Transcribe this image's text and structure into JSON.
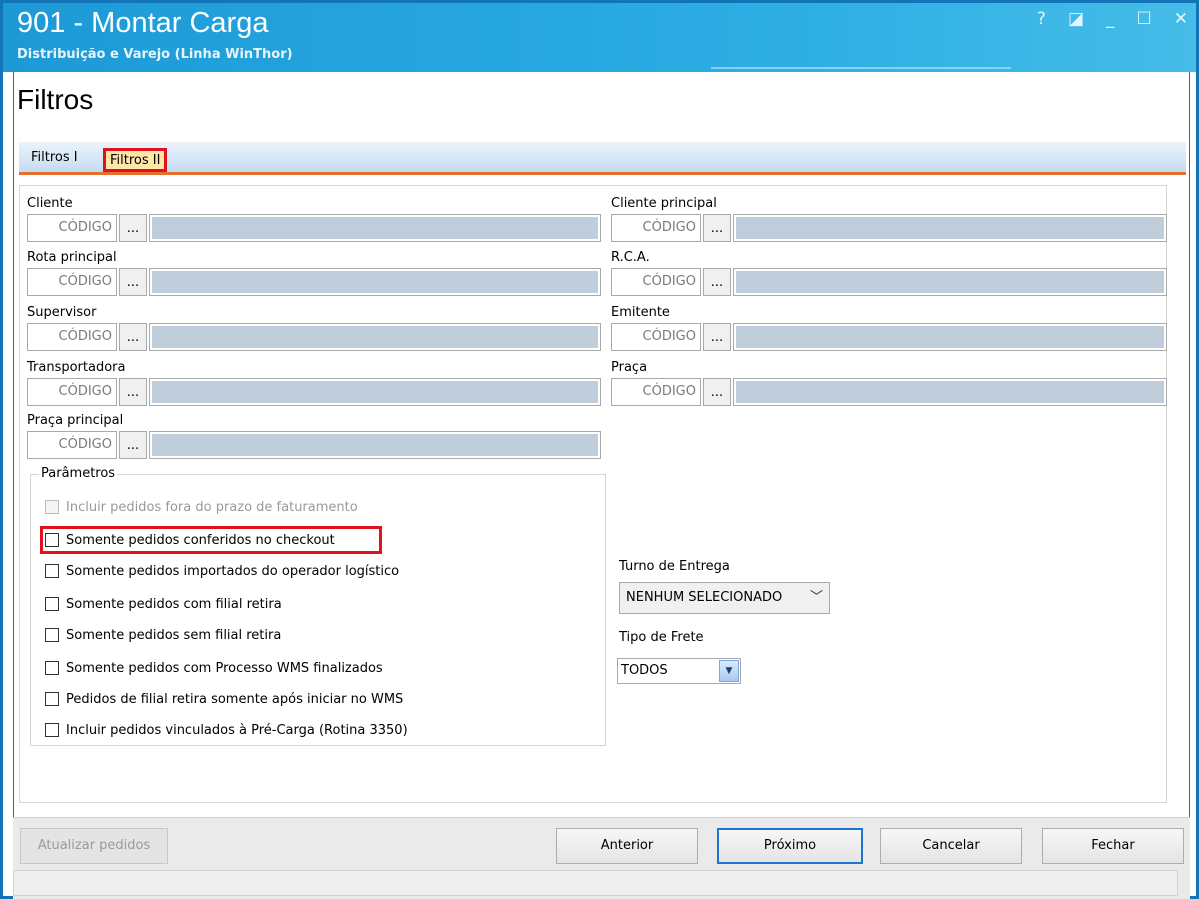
{
  "window": {
    "title": "901 - Montar Carga",
    "subtitle": "Distribuição e Varejo (Linha WinThor)",
    "controls": {
      "help": "?",
      "restore": "◪",
      "minimize": "_",
      "maximize": "☐",
      "close": "✕"
    }
  },
  "page": {
    "title": "Filtros"
  },
  "tabs": [
    {
      "label": "Filtros I",
      "active": false
    },
    {
      "label": "Filtros II",
      "active": true
    }
  ],
  "fields_left": [
    {
      "label": "Cliente",
      "code_placeholder": "CÓDIGO",
      "lookup": "..."
    },
    {
      "label": "Rota principal",
      "code_placeholder": "CÓDIGO",
      "lookup": "..."
    },
    {
      "label": "Supervisor",
      "code_placeholder": "CÓDIGO",
      "lookup": "..."
    },
    {
      "label": "Transportadora",
      "code_placeholder": "CÓDIGO",
      "lookup": "..."
    },
    {
      "label": "Praça principal",
      "code_placeholder": "CÓDIGO",
      "lookup": "..."
    }
  ],
  "fields_right": [
    {
      "label": "Cliente principal",
      "code_placeholder": "CÓDIGO",
      "lookup": "..."
    },
    {
      "label": "R.C.A.",
      "code_placeholder": "CÓDIGO",
      "lookup": "..."
    },
    {
      "label": "Emitente",
      "code_placeholder": "CÓDIGO",
      "lookup": "..."
    },
    {
      "label": "Praça",
      "code_placeholder": "CÓDIGO",
      "lookup": "..."
    }
  ],
  "parametros": {
    "title": "Parâmetros",
    "options": [
      {
        "label": "Incluir pedidos fora do prazo de faturamento",
        "checked": false,
        "enabled": false
      },
      {
        "label": "Somente pedidos conferidos no checkout",
        "checked": false,
        "enabled": true
      },
      {
        "label": "Somente pedidos importados do operador logístico",
        "checked": false,
        "enabled": true
      },
      {
        "label": "Somente pedidos com filial retira",
        "checked": false,
        "enabled": true
      },
      {
        "label": "Somente pedidos sem filial retira",
        "checked": false,
        "enabled": true
      },
      {
        "label": "Somente pedidos com Processo WMS finalizados",
        "checked": false,
        "enabled": true
      },
      {
        "label": "Pedidos de filial retira somente após iniciar no WMS",
        "checked": false,
        "enabled": true
      },
      {
        "label": "Incluir pedidos vinculados à Pré-Carga (Rotina 3350)",
        "checked": false,
        "enabled": true
      }
    ]
  },
  "turno_entrega": {
    "label": "Turno de Entrega",
    "value": "NENHUM SELECIONADO"
  },
  "tipo_frete": {
    "label": "Tipo de Frete",
    "value": "TODOS"
  },
  "footer": {
    "atualizar": "Atualizar pedidos",
    "anterior": "Anterior",
    "proximo": "Próximo",
    "cancelar": "Cancelar",
    "fechar": "Fechar"
  },
  "colors": {
    "titlebar": "#27a7e0",
    "highlight": "#e1121b",
    "tab_underline": "#e8702f",
    "desc_fill": "#c0cddb"
  }
}
